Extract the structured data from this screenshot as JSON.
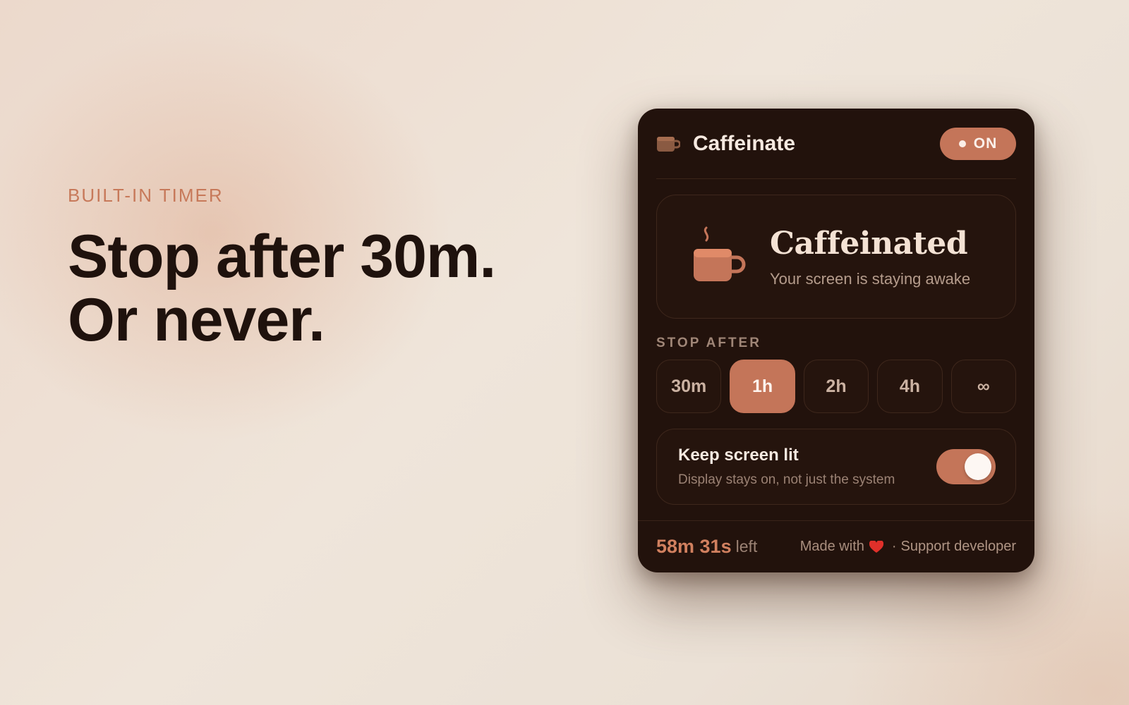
{
  "hero": {
    "eyebrow": "BUILT-IN TIMER",
    "headline_line1": "Stop after 30m.",
    "headline_line2": "Or never."
  },
  "panel": {
    "app_title": "Caffeinate",
    "app_icon": "mug-icon",
    "status_pill": "ON",
    "status_card": {
      "title": "Caffeinated",
      "subtitle": "Your screen is staying awake",
      "icon": "steaming-mug-icon"
    },
    "stop_after": {
      "label": "STOP AFTER",
      "options": [
        "30m",
        "1h",
        "2h",
        "4h",
        "∞"
      ],
      "selected": "1h"
    },
    "keep_screen_lit": {
      "title": "Keep screen lit",
      "subtitle": "Display stays on, not just the system",
      "enabled": true
    },
    "footer": {
      "time_remaining": "58m 31s",
      "time_suffix": "left",
      "made_with": "Made with",
      "heart_icon": "heart-icon",
      "separator": "·",
      "support_link": "Support developer"
    }
  },
  "colors": {
    "accent": "#c47559",
    "panel_bg": "#22120c",
    "eyebrow": "#c7795a",
    "headline": "#1f120d"
  }
}
